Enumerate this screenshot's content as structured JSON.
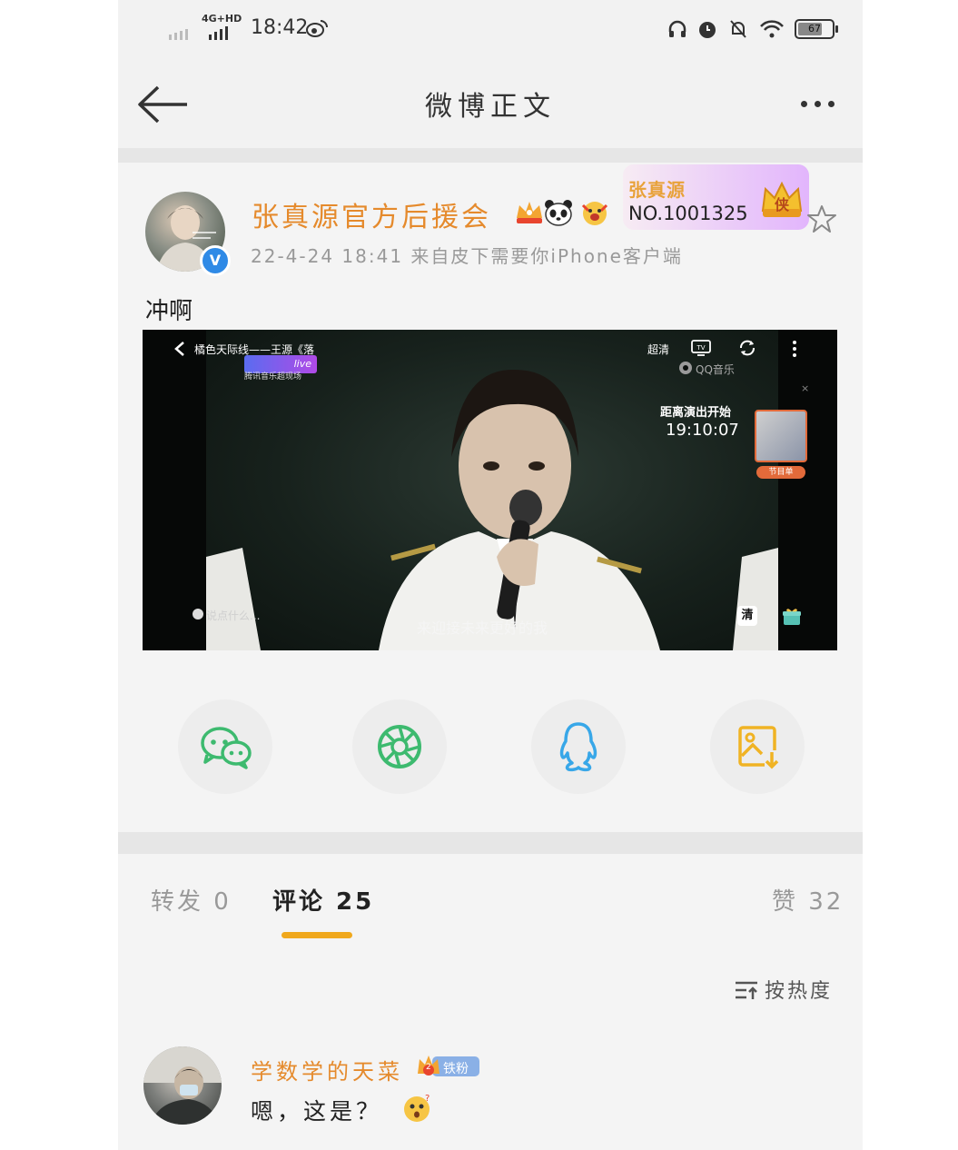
{
  "status_bar": {
    "time": "18:42",
    "network": "4G+HD",
    "battery": "67"
  },
  "nav": {
    "title": "微博正文"
  },
  "post": {
    "username": "张真源官方后援会",
    "fan_card": {
      "name": "张真源",
      "number": "NO.1001325",
      "badge_char": "侠"
    },
    "meta": "22-4-24 18:41  来自皮下需要你iPhone客户端",
    "text": "冲啊"
  },
  "video": {
    "title": "橘色天际线——王源《落",
    "quality": "超清",
    "logo_text": "live",
    "sub_logo": "腾讯音乐超现场",
    "app_label": "QQ音乐",
    "countdown_label": "距离演出开始",
    "countdown_time": "19:10:07",
    "thumb_tag": "节目单",
    "danmaku_placeholder": "说点什么...",
    "subtitle": "来迎接未来更好的我",
    "hd_button": "清"
  },
  "share": {
    "items": [
      {
        "icon": "wechat-icon",
        "color": "#3dba6f"
      },
      {
        "icon": "moments-icon",
        "color": "#3dba6f"
      },
      {
        "icon": "qq-icon",
        "color": "#38a7e8"
      },
      {
        "icon": "save-image-icon",
        "color": "#f0b324"
      }
    ]
  },
  "tabs": {
    "repost": "转发 0",
    "comments": "评论 25",
    "likes": "赞 32",
    "sort_label": "按热度"
  },
  "comment": {
    "username": "学数学的天菜",
    "badge": "铁粉",
    "badge_level": "2",
    "text": "嗯，这是？"
  },
  "colors": {
    "accent": "#f0a81c",
    "username": "#e58a2c",
    "verified": "#2f8ae6"
  }
}
